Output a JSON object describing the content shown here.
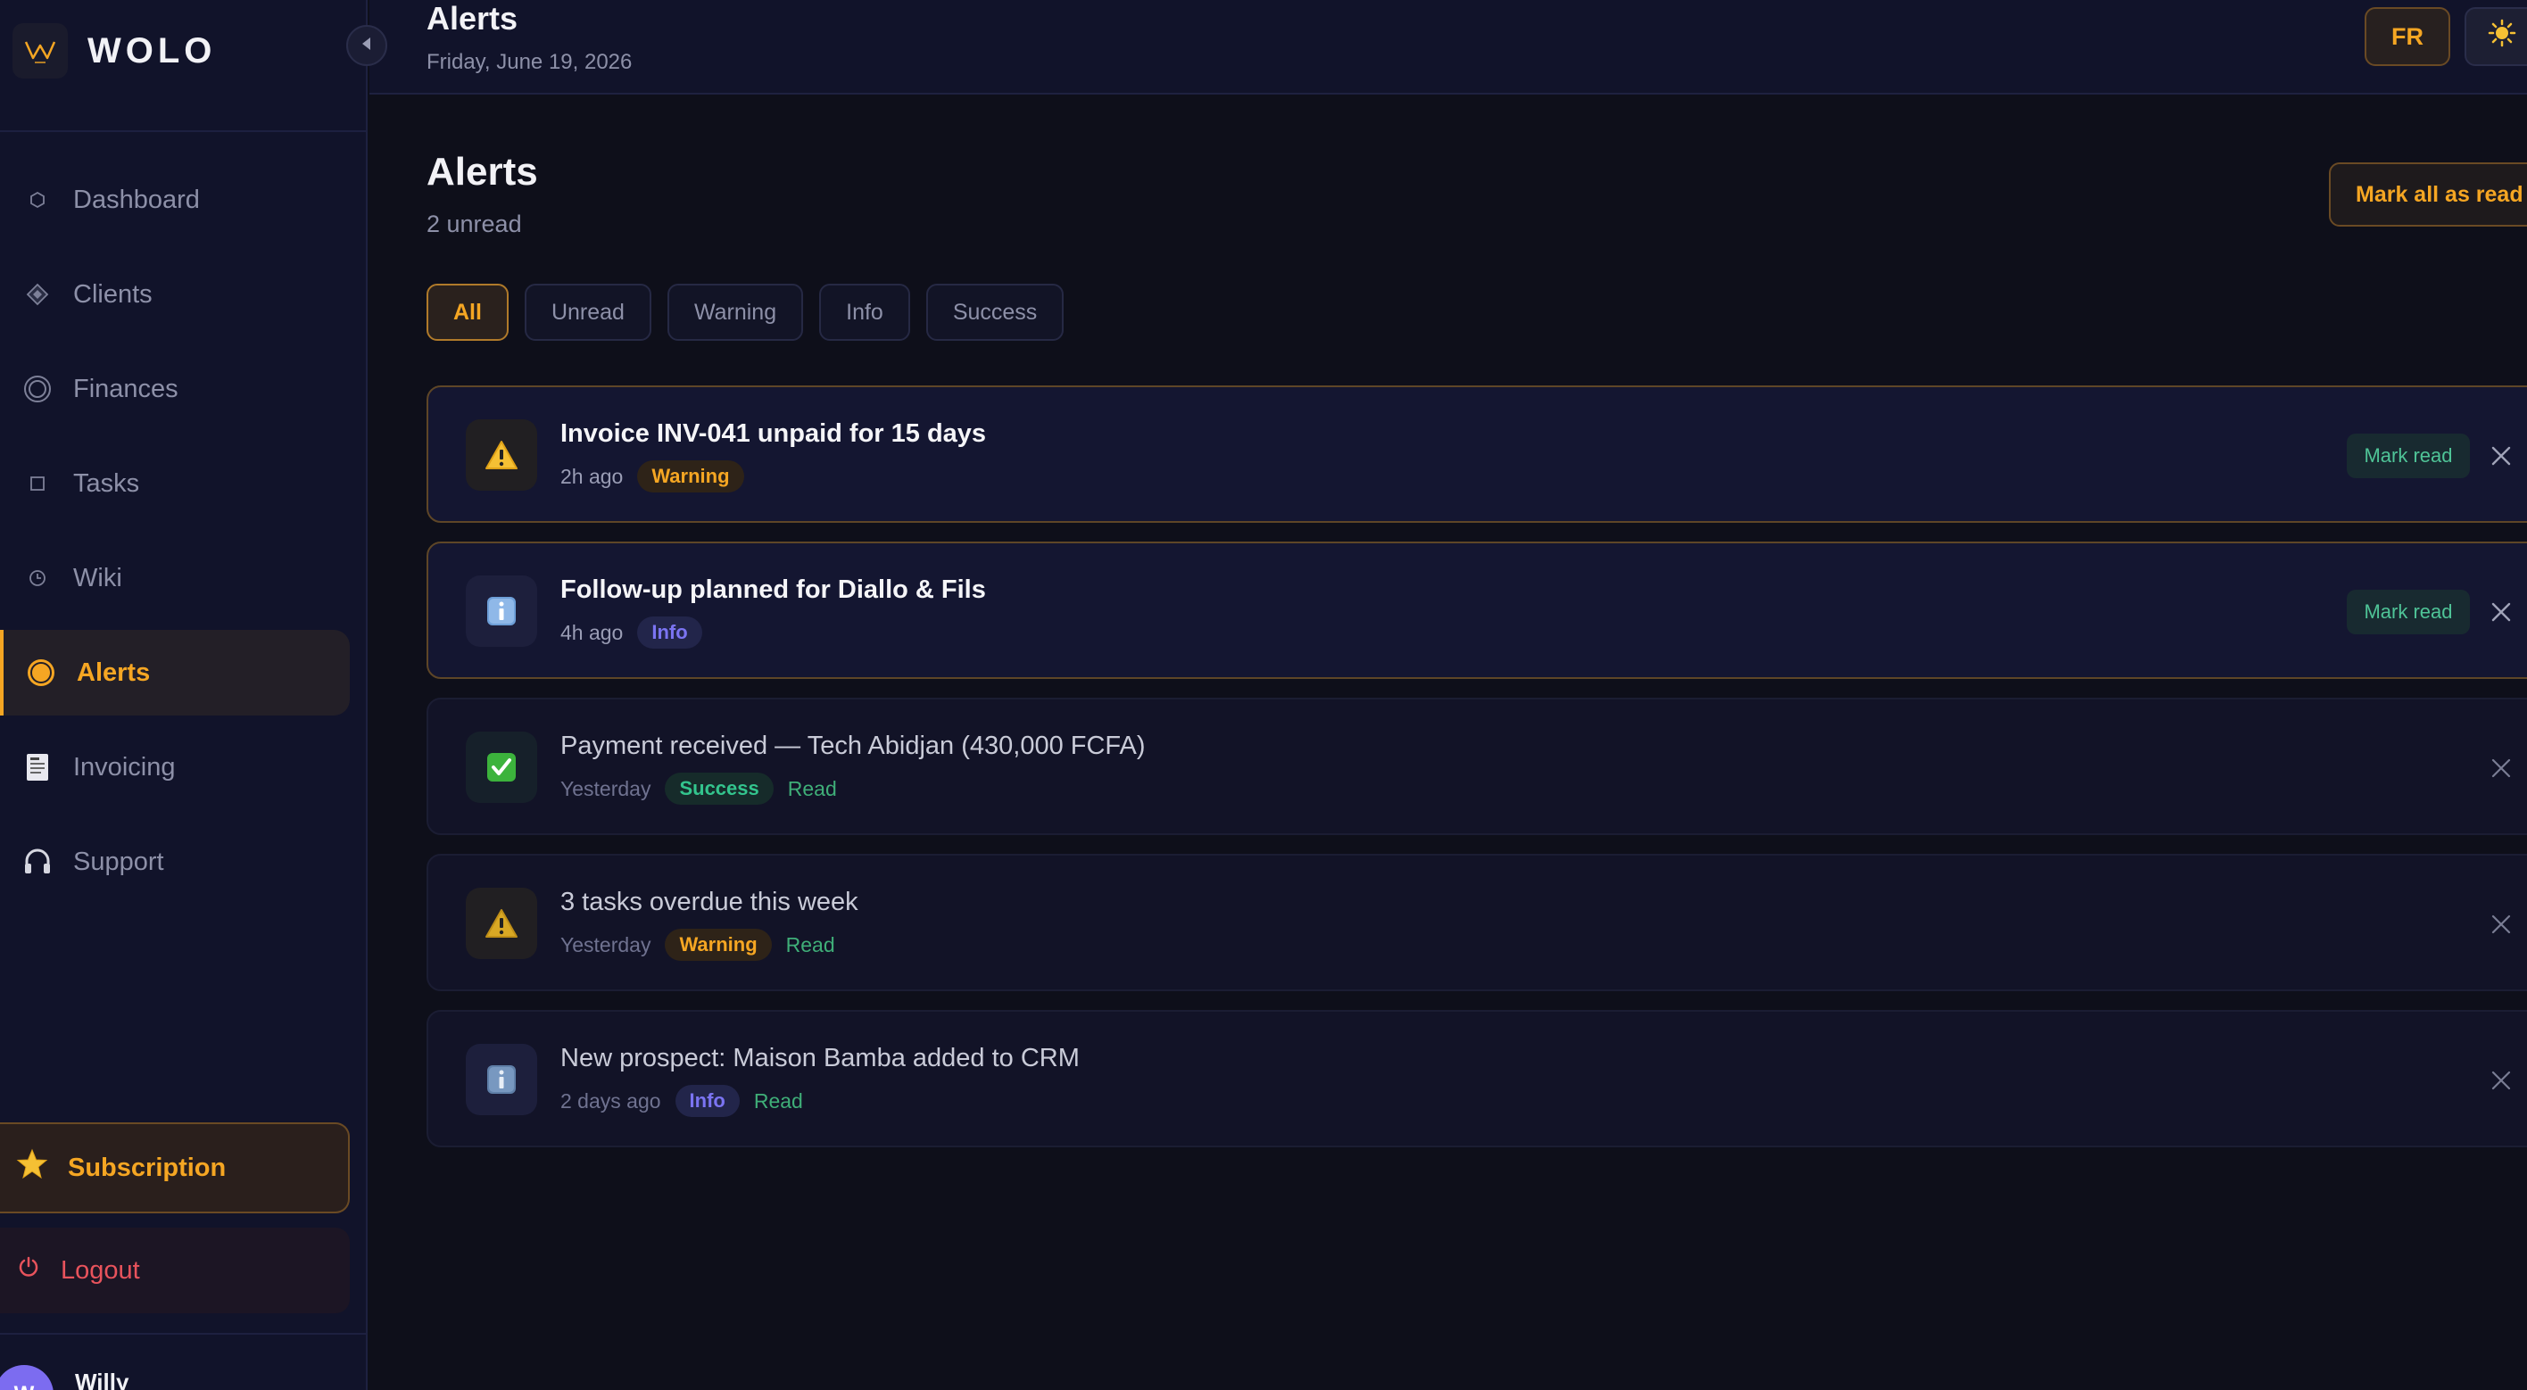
{
  "brand": {
    "name": "WOLO"
  },
  "sidebar": {
    "items": [
      {
        "label": "Dashboard",
        "icon": "hexagon-icon"
      },
      {
        "label": "Clients",
        "icon": "diamond-icon"
      },
      {
        "label": "Finances",
        "icon": "target-icon"
      },
      {
        "label": "Tasks",
        "icon": "square-icon"
      },
      {
        "label": "Wiki",
        "icon": "clock-icon"
      },
      {
        "label": "Alerts",
        "icon": "alert-dot-icon",
        "active": true
      },
      {
        "label": "Invoicing",
        "icon": "receipt-icon"
      },
      {
        "label": "Support",
        "icon": "headphones-icon"
      }
    ],
    "subscription_label": "Subscription",
    "logout_label": "Logout",
    "user": {
      "initials": "W",
      "name": "Willy"
    }
  },
  "topbar": {
    "title": "Alerts",
    "date": "Friday, June 19, 2026",
    "lang_label": "FR",
    "theme_icon": "sun-icon"
  },
  "main": {
    "title": "Alerts",
    "unread_count": "2 unread",
    "mark_all_label": "Mark all as read",
    "filters": [
      "All",
      "Unread",
      "Warning",
      "Info",
      "Success"
    ],
    "active_filter": "All",
    "mark_read_label": "Mark read",
    "read_label": "Read",
    "alerts": [
      {
        "title": "Invoice INV-041 unpaid for 15 days",
        "time": "2h ago",
        "type": "Warning",
        "unread": true
      },
      {
        "title": "Follow-up planned for Diallo & Fils",
        "time": "4h ago",
        "type": "Info",
        "unread": true
      },
      {
        "title": "Payment received — Tech Abidjan (430,000 FCFA)",
        "time": "Yesterday",
        "type": "Success",
        "unread": false
      },
      {
        "title": "3 tasks overdue this week",
        "time": "Yesterday",
        "type": "Warning",
        "unread": false
      },
      {
        "title": "New prospect: Maison Bamba added to CRM",
        "time": "2 days ago",
        "type": "Info",
        "unread": false
      }
    ]
  },
  "colors": {
    "accent": "#f5a623",
    "background": "#0e0f1a",
    "sidebar": "#11132a",
    "info": "#7b74f2",
    "success": "#33c48d",
    "danger": "#e8535c"
  }
}
